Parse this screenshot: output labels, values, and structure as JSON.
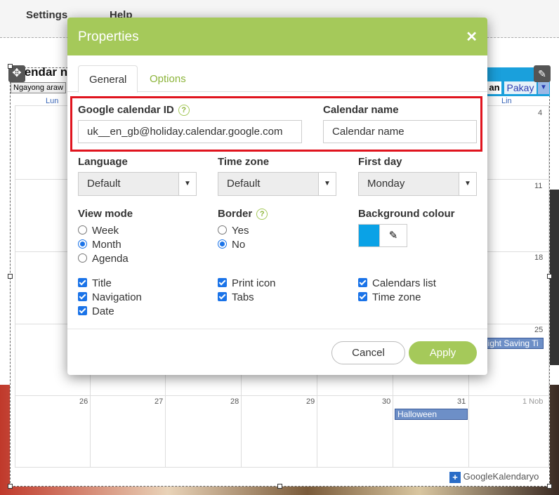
{
  "menubar": {
    "settings": "Settings",
    "help": "Help"
  },
  "calendar": {
    "title": "lendar n",
    "today_button": "Ngayong araw",
    "tab_partial": "an",
    "tab_pakay": "Pakay",
    "day_headers": {
      "first": "Lun",
      "last": "Lin"
    },
    "day_numbers": [
      "4",
      "11",
      "18",
      "25",
      "26",
      "27",
      "28",
      "29",
      "30",
      "31",
      "1 Nob"
    ],
    "events": [
      "light Saving Ti",
      "Halloween"
    ],
    "brand_google": "Google",
    "brand_suffix": "Kalendaryo"
  },
  "dialog": {
    "title": "Properties",
    "close": "✕",
    "tabs": [
      "General",
      "Options"
    ],
    "google_calendar_id": {
      "label": "Google calendar ID",
      "value": "uk__en_gb@holiday.calendar.google.com"
    },
    "calendar_name": {
      "label": "Calendar name",
      "placeholder": "Calendar name"
    },
    "language": {
      "label": "Language",
      "value": "Default"
    },
    "time_zone": {
      "label": "Time zone",
      "value": "Default"
    },
    "first_day": {
      "label": "First day",
      "value": "Monday"
    },
    "view_mode": {
      "label": "View mode",
      "options": [
        "Week",
        "Month",
        "Agenda"
      ],
      "selected": "Month"
    },
    "border": {
      "label": "Border",
      "options": [
        "Yes",
        "No"
      ],
      "selected": "No"
    },
    "background_colour": {
      "label": "Background colour",
      "color": "#0aa2e6"
    },
    "checkboxes": {
      "title": "Title",
      "navigation": "Navigation",
      "date": "Date",
      "print_icon": "Print icon",
      "tabs": "Tabs",
      "calendars_list": "Calendars list",
      "time_zone": "Time zone"
    },
    "buttons": {
      "cancel": "Cancel",
      "apply": "Apply"
    },
    "help_mark": "?"
  },
  "colors": {
    "header": "#a5c95a",
    "highlight": "#e0141e",
    "check": "#1a73e8"
  }
}
